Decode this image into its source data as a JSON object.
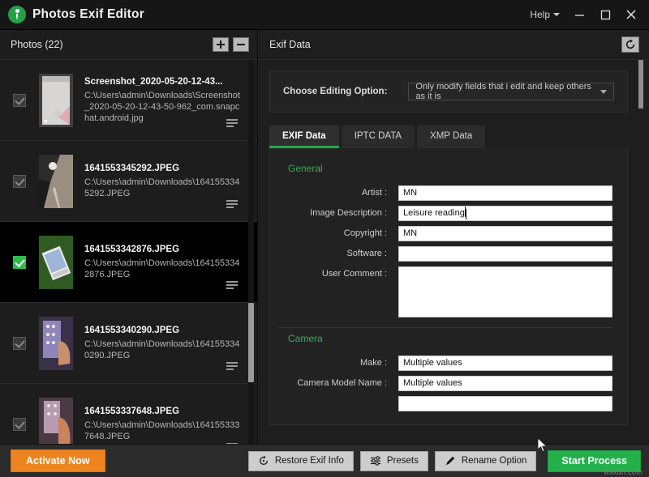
{
  "window": {
    "app_title": "Photos Exif Editor",
    "logo_icon": "location-person-icon",
    "help_label": "Help",
    "help_caret_icon": "chevron-down-icon",
    "minimize_icon": "minimize-icon",
    "maximize_icon": "maximize-icon",
    "close_icon": "close-icon"
  },
  "left_panel": {
    "title": "Photos (22)",
    "add_button_icon": "plus-icon",
    "remove_button_icon": "minus-icon",
    "row_menu_icon": "list-lines-icon",
    "items": [
      {
        "filename": "Screenshot_2020-05-20-12-43...",
        "path": "C:\\Users\\admin\\Downloads\\Screenshot_2020-05-20-12-43-50-962_com.snapchat.android.jpg",
        "checked": false,
        "selected": false
      },
      {
        "filename": "1641553345292.JPEG",
        "path": "C:\\Users\\admin\\Downloads\\1641553345292.JPEG",
        "checked": false,
        "selected": false
      },
      {
        "filename": "1641553342876.JPEG",
        "path": "C:\\Users\\admin\\Downloads\\1641553342876.JPEG",
        "checked": true,
        "selected": true
      },
      {
        "filename": "1641553340290.JPEG",
        "path": "C:\\Users\\admin\\Downloads\\1641553340290.JPEG",
        "checked": false,
        "selected": false
      },
      {
        "filename": "1641553337648.JPEG",
        "path": "C:\\Users\\admin\\Downloads\\1641553337648.JPEG",
        "checked": false,
        "selected": false
      }
    ]
  },
  "right_panel": {
    "title": "Exif Data",
    "refresh_icon": "refresh-icon",
    "editing_option": {
      "label": "Choose Editing Option:",
      "value": "Only modify fields that i edit and keep others as it is",
      "caret_icon": "caret-down-icon"
    },
    "tabs": [
      {
        "label": "EXIF Data",
        "active": true
      },
      {
        "label": "IPTC DATA",
        "active": false
      },
      {
        "label": "XMP Data",
        "active": false
      }
    ],
    "sections": [
      {
        "title": "General",
        "fields": [
          {
            "label": "Artist :",
            "value": "MN",
            "type": "input",
            "caret": false
          },
          {
            "label": "Image Description :",
            "value": "Leisure reading",
            "type": "input",
            "caret": true
          },
          {
            "label": "Copyright :",
            "value": "MN",
            "type": "input",
            "caret": false
          },
          {
            "label": "Software :",
            "value": "",
            "type": "input",
            "caret": false
          },
          {
            "label": "User Comment :",
            "value": "",
            "type": "textarea",
            "caret": false
          }
        ]
      },
      {
        "title": "Camera",
        "fields": [
          {
            "label": "Make :",
            "value": "Multiple values",
            "type": "input",
            "caret": false
          },
          {
            "label": "Camera Model Name :",
            "value": "Multiple values",
            "type": "input",
            "caret": false
          },
          {
            "label": "",
            "value": "",
            "type": "input",
            "caret": false
          }
        ]
      }
    ]
  },
  "bottom_bar": {
    "activate_label": "Activate Now",
    "restore_label": "Restore Exif Info",
    "restore_icon": "restore-clock-icon",
    "presets_label": "Presets",
    "presets_icon": "sliders-icon",
    "rename_label": "Rename Option",
    "rename_icon": "pencil-icon",
    "start_label": "Start Process"
  },
  "watermark": {
    "text": "wsxdn.com"
  },
  "colors": {
    "accent_green": "#24b14c",
    "section_green": "#3fa85f",
    "activate_orange": "#ee8420",
    "window_bg": "#1e1e1e"
  }
}
